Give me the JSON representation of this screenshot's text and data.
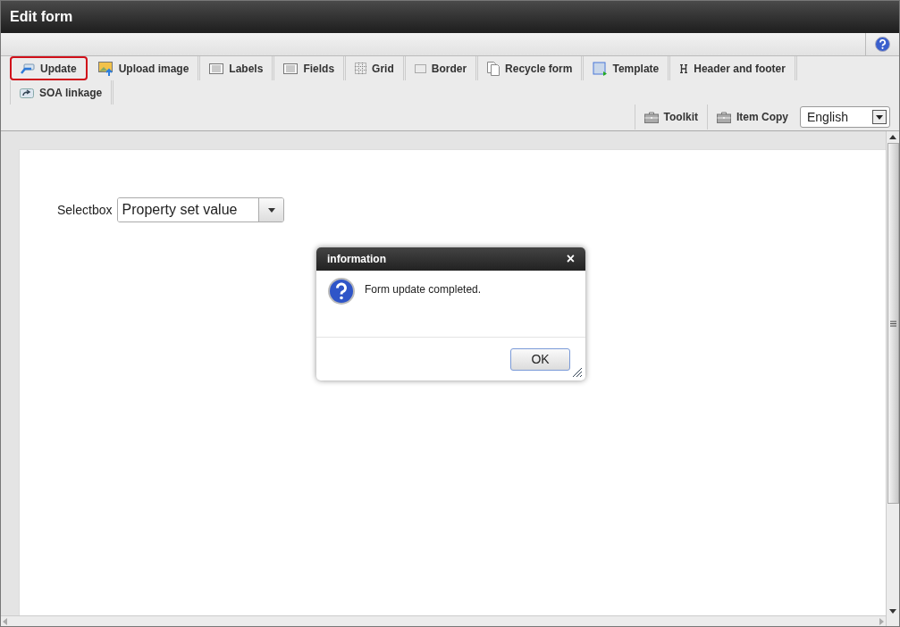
{
  "window": {
    "title": "Edit form"
  },
  "toolbar": [
    {
      "label": "Update",
      "kind": "update",
      "highlighted": true
    },
    {
      "label": "Upload image",
      "kind": "upload",
      "highlighted": false
    },
    {
      "label": "Labels",
      "kind": "list",
      "highlighted": false
    },
    {
      "label": "Fields",
      "kind": "list",
      "highlighted": false
    },
    {
      "label": "Grid",
      "kind": "grid",
      "highlighted": false
    },
    {
      "label": "Border",
      "kind": "border",
      "highlighted": false
    },
    {
      "label": "Recycle form",
      "kind": "pages",
      "highlighted": false
    },
    {
      "label": "Template",
      "kind": "template",
      "highlighted": false
    },
    {
      "label": "Header and footer",
      "kind": "heading",
      "highlighted": false
    },
    {
      "label": "SOA linkage",
      "kind": "share",
      "highlighted": false
    }
  ],
  "right_tools": [
    {
      "label": "Toolkit",
      "kind": "toolbox"
    },
    {
      "label": "Item Copy",
      "kind": "toolbox"
    }
  ],
  "language": {
    "value": "English"
  },
  "form": {
    "label": "Selectbox",
    "value": "Property set value"
  },
  "dialog": {
    "title": "information",
    "close": "×",
    "message": "Form update completed.",
    "button": "OK"
  }
}
